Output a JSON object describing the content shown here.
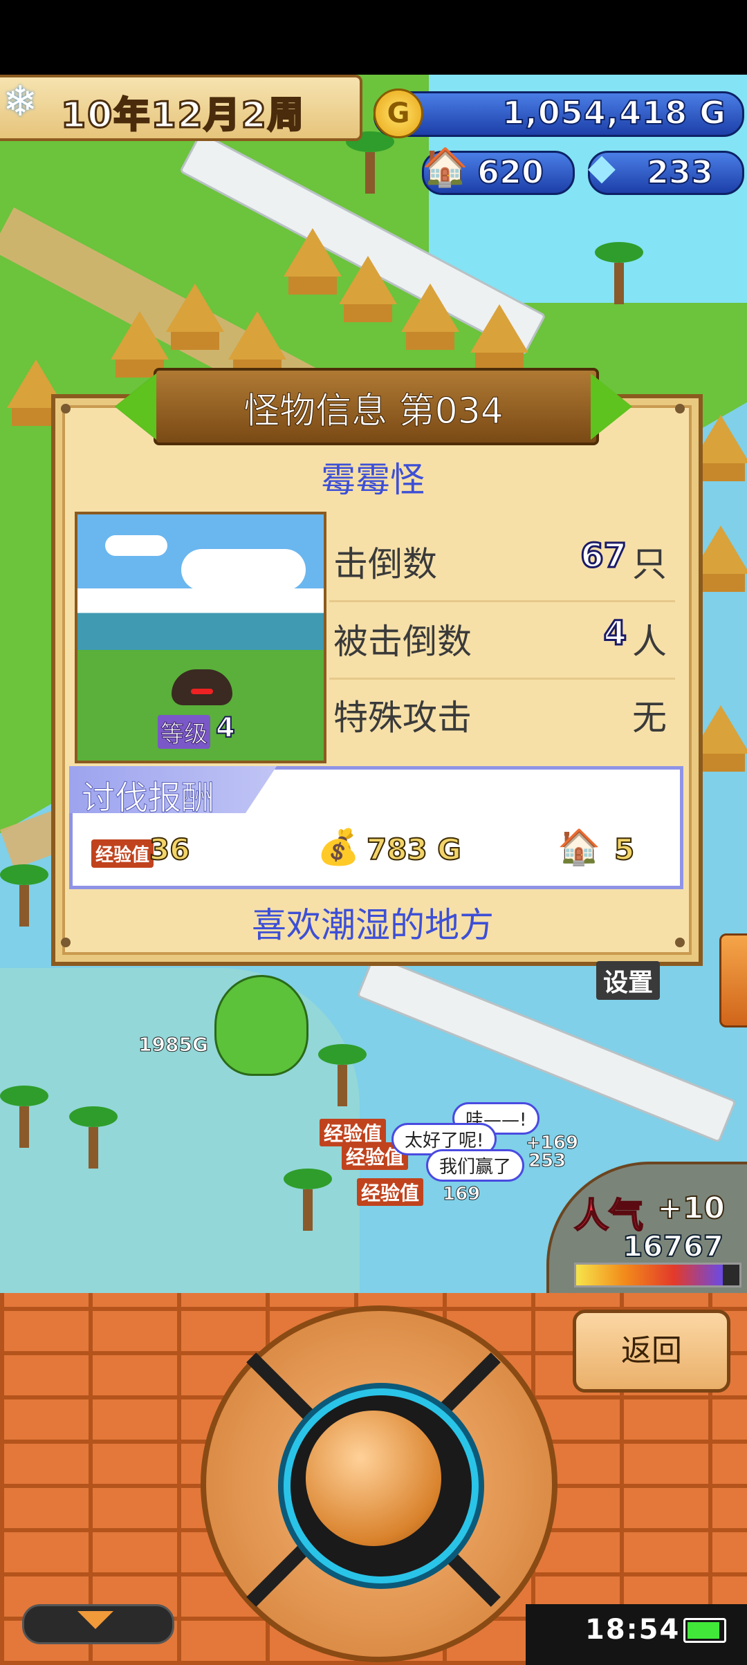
{
  "hud": {
    "date": "10年12月2周",
    "gold": "1,054,418 G",
    "coin_glyph": "G",
    "population": "620",
    "gems": "233"
  },
  "dialog": {
    "title": "怪物信息 第034",
    "monster_name": "霉霉怪",
    "level_label": "等级",
    "level_value": "4",
    "stats": [
      {
        "label": "击倒数",
        "value": "67",
        "unit": "只"
      },
      {
        "label": "被击倒数",
        "value": "4",
        "unit": "人"
      },
      {
        "label": "特殊攻击",
        "value": "",
        "unit": "无"
      }
    ],
    "reward": {
      "title": "讨伐报酬",
      "exp_label": "经验值",
      "exp_value": "36",
      "gold_value": "783 G",
      "house_value": "5"
    },
    "hint": "喜欢潮湿的地方"
  },
  "map": {
    "settings_label": "设置",
    "dragon_damage": "1985G",
    "bubbles": [
      "哇——!",
      "太好了呢!",
      "我们赢了"
    ],
    "float_numbers": [
      "+169",
      "253",
      "169"
    ],
    "exp_tag": "经验值",
    "popularity_label": "人气",
    "popularity_plus": "+10",
    "popularity_count": "16767",
    "popularity_level": 0.9
  },
  "controls": {
    "back_label": "返回"
  },
  "system": {
    "time": "18:54"
  },
  "colors": {
    "accent_blue": "#3d4fd6",
    "panel_bg": "#f6e0a8",
    "frame_brown": "#8b5a1f",
    "arrow_green": "#5ec21f",
    "brick_orange": "#e3783a"
  }
}
